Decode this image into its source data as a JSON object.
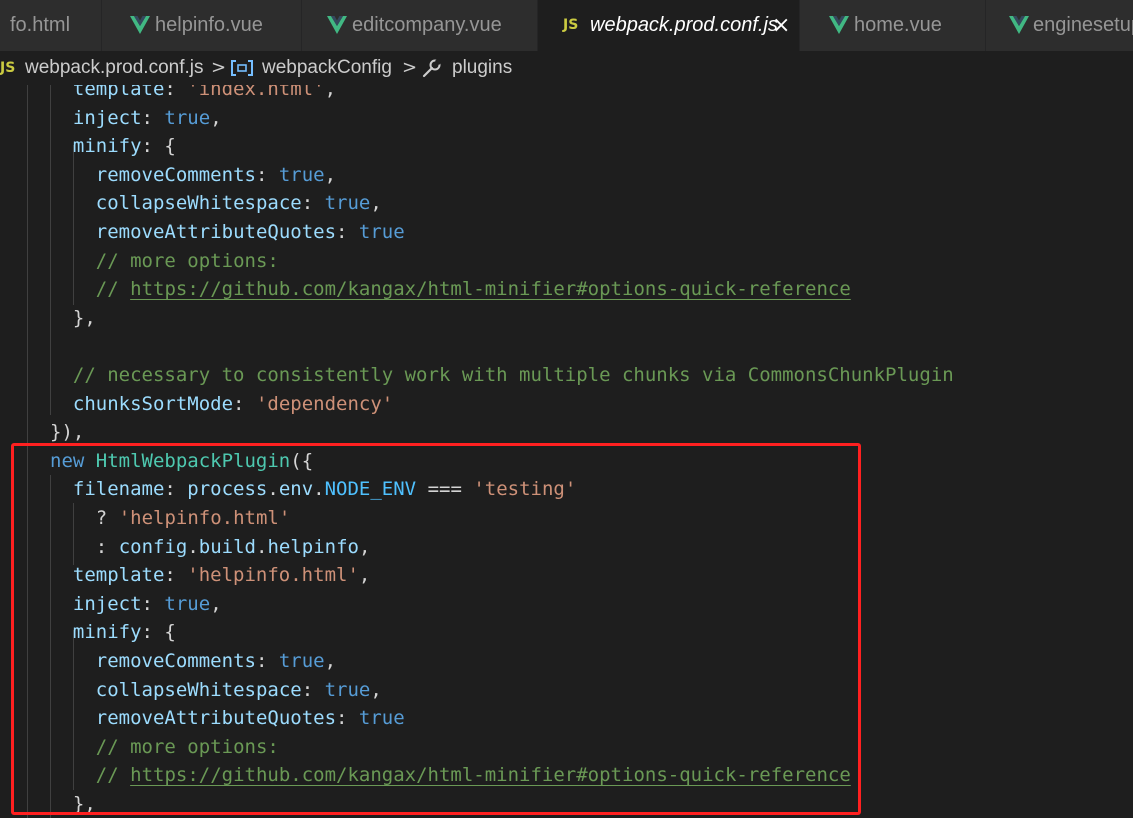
{
  "tabs": [
    {
      "label": "fo.html",
      "icon": "",
      "active": false
    },
    {
      "label": "helpinfo.vue",
      "icon": "vue-icon",
      "active": false
    },
    {
      "label": "editcompany.vue",
      "icon": "vue-icon",
      "active": false
    },
    {
      "label": "webpack.prod.conf.js",
      "icon": "js-icon",
      "icon_text": "JS",
      "active": true,
      "close": "×"
    },
    {
      "label": "home.vue",
      "icon": "vue-icon",
      "active": false
    },
    {
      "label": "enginesetup",
      "icon": "vue-icon",
      "active": false
    }
  ],
  "breadcrumb": {
    "file_icon_text": "JS",
    "file": "webpack.prod.conf.js",
    "separator": ">",
    "symbol_icon": "variable-icon",
    "symbol": "webpackConfig",
    "property_icon": "wrench-icon",
    "property": "plugins"
  },
  "code": [
    {
      "indent": 3,
      "tokens": [
        {
          "t": "template",
          "c": "prop"
        },
        {
          "t": ": ",
          "c": "plain"
        },
        {
          "t": "'index.html'",
          "c": "str"
        },
        {
          "t": ",",
          "c": "plain"
        }
      ]
    },
    {
      "indent": 3,
      "tokens": [
        {
          "t": "inject",
          "c": "prop"
        },
        {
          "t": ": ",
          "c": "plain"
        },
        {
          "t": "true",
          "c": "bool"
        },
        {
          "t": ",",
          "c": "plain"
        }
      ]
    },
    {
      "indent": 3,
      "tokens": [
        {
          "t": "minify",
          "c": "prop"
        },
        {
          "t": ": {",
          "c": "plain"
        }
      ]
    },
    {
      "indent": 4,
      "tokens": [
        {
          "t": "removeComments",
          "c": "prop"
        },
        {
          "t": ": ",
          "c": "plain"
        },
        {
          "t": "true",
          "c": "bool"
        },
        {
          "t": ",",
          "c": "plain"
        }
      ]
    },
    {
      "indent": 4,
      "tokens": [
        {
          "t": "collapseWhitespace",
          "c": "prop"
        },
        {
          "t": ": ",
          "c": "plain"
        },
        {
          "t": "true",
          "c": "bool"
        },
        {
          "t": ",",
          "c": "plain"
        }
      ]
    },
    {
      "indent": 4,
      "tokens": [
        {
          "t": "removeAttributeQuotes",
          "c": "prop"
        },
        {
          "t": ": ",
          "c": "plain"
        },
        {
          "t": "true",
          "c": "bool"
        }
      ]
    },
    {
      "indent": 4,
      "tokens": [
        {
          "t": "// more options:",
          "c": "comment"
        }
      ]
    },
    {
      "indent": 4,
      "tokens": [
        {
          "t": "// ",
          "c": "comment"
        },
        {
          "t": "https://github.com/kangax/html-minifier#options-quick-reference",
          "c": "link"
        }
      ]
    },
    {
      "indent": 3,
      "tokens": [
        {
          "t": "},",
          "c": "plain"
        }
      ]
    },
    {
      "indent": 0,
      "tokens": []
    },
    {
      "indent": 3,
      "tokens": [
        {
          "t": "// necessary to consistently work with multiple chunks via CommonsChunkPlugin",
          "c": "comment"
        }
      ]
    },
    {
      "indent": 3,
      "tokens": [
        {
          "t": "chunksSortMode",
          "c": "prop"
        },
        {
          "t": ": ",
          "c": "plain"
        },
        {
          "t": "'dependency'",
          "c": "str"
        }
      ]
    },
    {
      "indent": 2,
      "tokens": [
        {
          "t": "}),",
          "c": "plain"
        }
      ]
    },
    {
      "indent": 2,
      "tokens": [
        {
          "t": "new",
          "c": "kw"
        },
        {
          "t": " ",
          "c": "plain"
        },
        {
          "t": "HtmlWebpackPlugin",
          "c": "class"
        },
        {
          "t": "({",
          "c": "plain"
        }
      ]
    },
    {
      "indent": 3,
      "tokens": [
        {
          "t": "filename",
          "c": "prop"
        },
        {
          "t": ": ",
          "c": "plain"
        },
        {
          "t": "process",
          "c": "var"
        },
        {
          "t": ".",
          "c": "plain"
        },
        {
          "t": "env",
          "c": "var"
        },
        {
          "t": ".",
          "c": "plain"
        },
        {
          "t": "NODE_ENV",
          "c": "const"
        },
        {
          "t": " === ",
          "c": "plain"
        },
        {
          "t": "'testing'",
          "c": "str"
        }
      ]
    },
    {
      "indent": 4,
      "tokens": [
        {
          "t": "? ",
          "c": "plain"
        },
        {
          "t": "'helpinfo.html'",
          "c": "str"
        }
      ]
    },
    {
      "indent": 4,
      "tokens": [
        {
          "t": ": ",
          "c": "plain"
        },
        {
          "t": "config",
          "c": "var"
        },
        {
          "t": ".",
          "c": "plain"
        },
        {
          "t": "build",
          "c": "var"
        },
        {
          "t": ".",
          "c": "plain"
        },
        {
          "t": "helpinfo",
          "c": "var"
        },
        {
          "t": ",",
          "c": "plain"
        }
      ]
    },
    {
      "indent": 3,
      "tokens": [
        {
          "t": "template",
          "c": "prop"
        },
        {
          "t": ": ",
          "c": "plain"
        },
        {
          "t": "'helpinfo.html'",
          "c": "str"
        },
        {
          "t": ",",
          "c": "plain"
        }
      ]
    },
    {
      "indent": 3,
      "tokens": [
        {
          "t": "inject",
          "c": "prop"
        },
        {
          "t": ": ",
          "c": "plain"
        },
        {
          "t": "true",
          "c": "bool"
        },
        {
          "t": ",",
          "c": "plain"
        }
      ]
    },
    {
      "indent": 3,
      "tokens": [
        {
          "t": "minify",
          "c": "prop"
        },
        {
          "t": ": {",
          "c": "plain"
        }
      ]
    },
    {
      "indent": 4,
      "tokens": [
        {
          "t": "removeComments",
          "c": "prop"
        },
        {
          "t": ": ",
          "c": "plain"
        },
        {
          "t": "true",
          "c": "bool"
        },
        {
          "t": ",",
          "c": "plain"
        }
      ]
    },
    {
      "indent": 4,
      "tokens": [
        {
          "t": "collapseWhitespace",
          "c": "prop"
        },
        {
          "t": ": ",
          "c": "plain"
        },
        {
          "t": "true",
          "c": "bool"
        },
        {
          "t": ",",
          "c": "plain"
        }
      ]
    },
    {
      "indent": 4,
      "tokens": [
        {
          "t": "removeAttributeQuotes",
          "c": "prop"
        },
        {
          "t": ": ",
          "c": "plain"
        },
        {
          "t": "true",
          "c": "bool"
        }
      ]
    },
    {
      "indent": 4,
      "tokens": [
        {
          "t": "// more options:",
          "c": "comment"
        }
      ]
    },
    {
      "indent": 4,
      "tokens": [
        {
          "t": "// ",
          "c": "comment"
        },
        {
          "t": "https://github.com/kangax/html-minifier#options-quick-reference",
          "c": "link"
        }
      ]
    },
    {
      "indent": 3,
      "tokens": [
        {
          "t": "},",
          "c": "plain"
        }
      ]
    }
  ],
  "colors": {
    "background": "#1e1e1e",
    "tab_bar": "#252526",
    "inactive_tab": "#2d2d2d",
    "vue_green": "#41b883",
    "js_yellow": "#cbcb41",
    "highlight_red": "#ff2020"
  },
  "annotation": {
    "shape": "rectangle",
    "color": "#ff2020"
  }
}
